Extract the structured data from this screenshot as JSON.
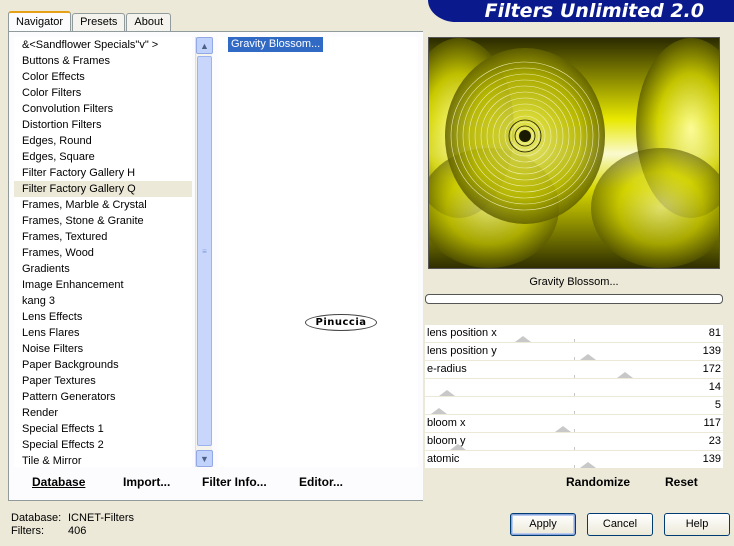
{
  "app": {
    "title": "Filters Unlimited 2.0"
  },
  "tabs": [
    {
      "label": "Navigator",
      "active": true
    },
    {
      "label": "Presets",
      "active": false
    },
    {
      "label": "About",
      "active": false
    }
  ],
  "categories": {
    "items": [
      "&<Sandflower Specials\"v\" >",
      "Buttons & Frames",
      "Color Effects",
      "Color Filters",
      "Convolution Filters",
      "Distortion Filters",
      "Edges, Round",
      "Edges, Square",
      "Filter Factory Gallery H",
      "Filter Factory Gallery Q",
      "Frames, Marble & Crystal",
      "Frames, Stone & Granite",
      "Frames, Textured",
      "Frames, Wood",
      "Gradients",
      "Image Enhancement",
      "kang 3",
      "Lens Effects",
      "Lens Flares",
      "Noise Filters",
      "Paper Backgrounds",
      "Paper Textures",
      "Pattern Generators",
      "Render",
      "Special Effects 1",
      "Special Effects 2",
      "Tile & Mirror"
    ],
    "selected_index": 9
  },
  "filters": {
    "selected": "Gravity Blossom..."
  },
  "watermark": "Pinuccia",
  "preview": {
    "filter_name": "Gravity Blossom...",
    "progress": 0
  },
  "parameters": [
    {
      "label": "lens position x",
      "value": "81",
      "level": 0.32
    },
    {
      "label": "lens position y",
      "value": "139",
      "level": 0.55
    },
    {
      "label": "e-radius",
      "value": "172",
      "level": 0.68
    },
    {
      "label": "",
      "value": "14",
      "level": 0.05
    },
    {
      "label": "",
      "value": "5",
      "level": 0.02
    },
    {
      "label": "bloom x",
      "value": "117",
      "level": 0.46
    },
    {
      "label": "bloom y",
      "value": "23",
      "level": 0.09
    },
    {
      "label": "atomic",
      "value": "139",
      "level": 0.55
    }
  ],
  "buttons": {
    "database": "Database",
    "import": "Import...",
    "filter_info": "Filter Info...",
    "editor": "Editor...",
    "randomize": "Randomize",
    "reset": "Reset",
    "apply": "Apply",
    "cancel": "Cancel",
    "help": "Help"
  },
  "footer": {
    "database_label": "Database:",
    "database_value": "ICNET-Filters",
    "filters_label": "Filters:",
    "filters_value": "406"
  },
  "colors": {
    "banner": "#0a1a8c",
    "selection": "#316ac5",
    "preview_primary": "#c8c800",
    "preview_dark": "#1a1a00"
  }
}
